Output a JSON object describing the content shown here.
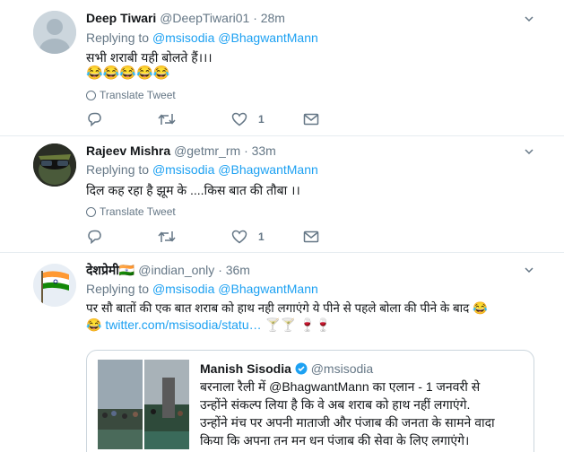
{
  "tweets": [
    {
      "name": "Deep Tiwari",
      "handle": "@DeepTiwari01",
      "time": "· 28m",
      "replying_prefix": "Replying to",
      "replying_to": "@msisodia @BhagwantMann",
      "text": "सभी शराबी यही बोलते हैं।।।",
      "emoji": "😂😂😂😂😂",
      "translate": "Translate Tweet",
      "likes": "1"
    },
    {
      "name": "Rajeev Mishra",
      "handle": "@getmr_rm",
      "time": "· 33m",
      "replying_prefix": "Replying to",
      "replying_to": "@msisodia @BhagwantMann",
      "text": "दिल कह रहा है झूम के ....किस बात की तौबा ।।",
      "translate": "Translate Tweet",
      "likes": "1"
    },
    {
      "name": "देशप्रेमी",
      "flag": "🇮🇳",
      "handle": "@indian_only",
      "time": "· 36m",
      "replying_prefix": "Replying to",
      "replying_to": "@msisodia @BhagwantMann",
      "text_line1": "पर सौ बातों की एक बात शराब को हाथ नही लगाएंगे ये पीने से पहले बोला की पीने के बाद 😂",
      "text_line2_emoji": "😂",
      "text_line2_link": "twitter.com/msisodia/statu…",
      "text_line2_glasses": " 🍸🍸 🍷🍷"
    }
  ],
  "quote": {
    "name": "Manish Sisodia",
    "handle": "@msisodia",
    "lines": [
      "बरनाला रैली में @BhagwantMann का एलान - 1 जनवरी से",
      "उन्होंने संकल्प लिया है कि वे अब शराब को हाथ नहीं लगाएंगे.",
      "उन्होंने मंच पर अपनी माताजी और पंजाब की जनता के सामने वादा",
      "किया कि अपना तन मन धन पंजाब की सेवा के लिए लगाएंगे।"
    ]
  },
  "colors": {
    "link": "#1da1f2",
    "muted": "#657786",
    "verified": "#1da1f2"
  },
  "icons": [
    "reply-icon",
    "retweet-icon",
    "like-icon",
    "message-icon",
    "globe-icon",
    "chevron-down-icon"
  ]
}
